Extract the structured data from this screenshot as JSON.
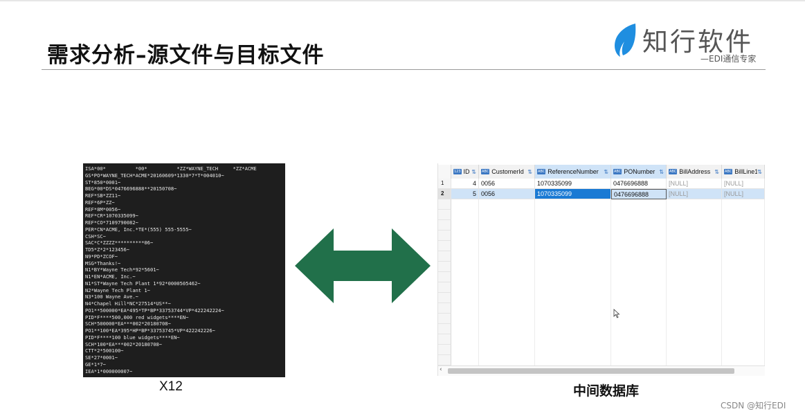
{
  "slide": {
    "title": "需求分析–源文件与目标文件",
    "logo": {
      "name": "知行软件",
      "tagline": "—EDI通信专家",
      "accent_color": "#1f8ee0"
    },
    "watermark": "CSDN @知行EDI"
  },
  "source": {
    "caption": "X12",
    "lines": [
      "ISA*00*          *00*          *ZZ*WAYNE_TECH     *ZZ*ACME",
      "GS*PO*WAYNE_TECH*ACME*20160609*1330*7*T*004010~",
      "ST*850*0001~",
      "BEG*00*DS*0476696888**20150708~",
      "REF*SB*ZZ11~",
      "REF*6P*ZZ~",
      "REF*8M*0056~",
      "REF*CR*1070335099~",
      "REF*CO*7109790082~",
      "PER*CN*ACME, Inc.*TE*(555) 555-5555~",
      "CSH*SC~",
      "SAC*C*ZZZZ**********06~",
      "TD5*Z*2*123456~",
      "N9*PD*ZCOF~",
      "MSG*Thanks!~",
      "N1*BY*Wayne Tech*92*5601~",
      "N1*EN*ACME, Inc.~",
      "N1*ST*Wayne Tech Plant 1*92*0000505462~",
      "N2*Wayne Tech Plant 1~",
      "N3*100 Wayne Ave.~",
      "N4*Chapel Hill*NC*27514*US**~",
      "PO1**500000*EA*495*TP*BP*33753744*VP*422242224~",
      "PID*F****500,000 red widgets****EN~",
      "SCH*500000*EA***002*20180708~",
      "PO1**100*EA*395*HP*BP*33753745*VP*422242226~",
      "PID*F****100 blue widgets****EN~",
      "SCH*100*EA***002*20180708~",
      "CTT*2*500100~",
      "SE*27*0001~",
      "GE*1*7~",
      "IEA*1*000000007~"
    ]
  },
  "database": {
    "caption": "中间数据库",
    "columns": [
      {
        "name": "ID",
        "type_icon": "123",
        "selected": false
      },
      {
        "name": "CustomerId",
        "type_icon": "ABC",
        "selected": false
      },
      {
        "name": "ReferenceNumber",
        "type_icon": "ABC",
        "selected": true
      },
      {
        "name": "PONumber",
        "type_icon": "ABC",
        "selected": true
      },
      {
        "name": "BillAddress",
        "type_icon": "ABC",
        "selected": false
      },
      {
        "name": "BillLine1",
        "type_icon": "ABC",
        "selected": false
      }
    ],
    "rows": [
      {
        "rownum": "1",
        "ID": "4",
        "CustomerId": "0056",
        "ReferenceNumber": "1070335099",
        "PONumber": "0476696888",
        "BillAddress": "[NULL]",
        "BillLine1": "[NULL]"
      },
      {
        "rownum": "2",
        "ID": "5",
        "CustomerId": "0056",
        "ReferenceNumber": "1070335099",
        "PONumber": "0476696888",
        "BillAddress": "[NULL]",
        "BillLine1": "[NULL]"
      }
    ],
    "selected_row": 2
  },
  "arrow": {
    "color": "#21704a"
  }
}
